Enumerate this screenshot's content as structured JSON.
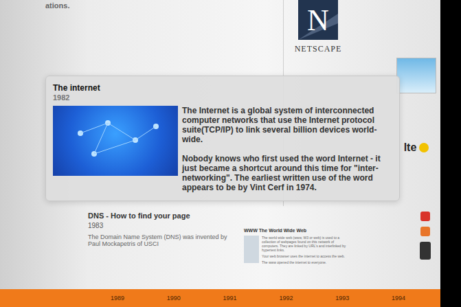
{
  "page": {
    "fragment": "ations."
  },
  "logo": {
    "letter": "N",
    "name": "NETSCAPE"
  },
  "tooltip": {
    "title": "The internet",
    "year": "1982",
    "paragraphs": [
      "The Internet is a global system of interconnected computer networks that use the Internet protocol suite(TCP/IP) to link several billion devices world-wide.",
      "Nobody knows who first used the word Internet - it just became a shortcut around this time for \"inter-networking\". The earliest written use of the word appears to be by Vint Cerf in 1974."
    ]
  },
  "entries": [
    {
      "title": "DNS - How to find your page",
      "year": "1983",
      "text": "The Domain Name System (DNS) was invented by Paul Mockapetris of USCI"
    }
  ],
  "www_card": {
    "title": "WWW The World Wide Web",
    "lines": [
      "The world wide web (www, W3 or web) is used to a collection of webpages found on this network of computers. They are linked by URL's and interlinked by hypertext links.",
      "Your web browser uses the internet to access the web.",
      "The www opened the internet to everyone."
    ]
  },
  "side_logo": {
    "text": "lte"
  },
  "timeline": {
    "years": [
      "1989",
      "1990",
      "1991",
      "1992",
      "1993",
      "1994"
    ]
  }
}
